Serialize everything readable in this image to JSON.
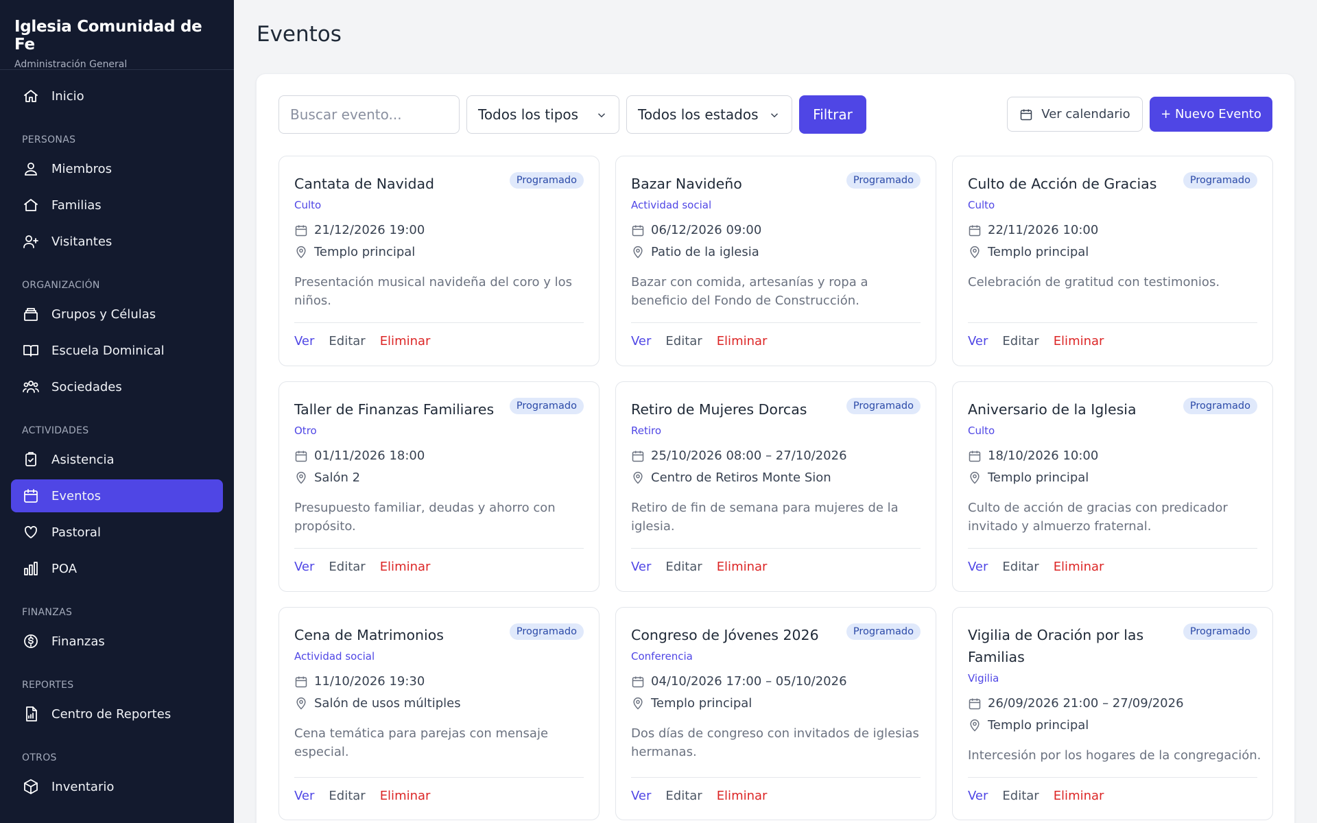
{
  "brand": {
    "title": "Iglesia Comunidad de Fe",
    "subtitle": "Administración General"
  },
  "nav": {
    "inicio": "Inicio",
    "personas": {
      "section": "PERSONAS",
      "items": [
        "Miembros",
        "Familias",
        "Visitantes"
      ]
    },
    "organizacion": {
      "section": "ORGANIZACIÓN",
      "items": [
        "Grupos y Células",
        "Escuela Dominical",
        "Sociedades"
      ]
    },
    "actividades": {
      "section": "ACTIVIDADES",
      "items": [
        "Asistencia",
        "Eventos",
        "Pastoral",
        "POA"
      ]
    },
    "finanzas": {
      "section": "FINANZAS",
      "items": [
        "Finanzas"
      ]
    },
    "reportes": {
      "section": "REPORTES",
      "items": [
        "Centro de Reportes"
      ]
    },
    "otros": {
      "section": "OTROS",
      "items": [
        "Inventario"
      ]
    }
  },
  "page": {
    "title": "Eventos"
  },
  "toolbar": {
    "search_placeholder": "Buscar evento...",
    "type_select": "Todos los tipos",
    "status_select": "Todos los estados",
    "filter_label": "Filtrar",
    "calendar_label": "Ver calendario",
    "new_label": "+ Nuevo Evento"
  },
  "actions": {
    "ver": "Ver",
    "editar": "Editar",
    "eliminar": "Eliminar"
  },
  "events": [
    {
      "title": "Cantata de Navidad",
      "status": "Programado",
      "type": "Culto",
      "date": "21/12/2026 19:00",
      "location": "Templo principal",
      "description": "Presentación musical navideña del coro y los niños."
    },
    {
      "title": "Bazar Navideño",
      "status": "Programado",
      "type": "Actividad social",
      "date": "06/12/2026 09:00",
      "location": "Patio de la iglesia",
      "description": "Bazar con comida, artesanías y ropa a beneficio del Fondo de Construcción."
    },
    {
      "title": "Culto de Acción de Gracias",
      "status": "Programado",
      "type": "Culto",
      "date": "22/11/2026 10:00",
      "location": "Templo principal",
      "description": "Celebración de gratitud con testimonios."
    },
    {
      "title": "Taller de Finanzas Familiares",
      "status": "Programado",
      "type": "Otro",
      "date": "01/11/2026 18:00",
      "location": "Salón 2",
      "description": "Presupuesto familiar, deudas y ahorro con propósito."
    },
    {
      "title": "Retiro de Mujeres Dorcas",
      "status": "Programado",
      "type": "Retiro",
      "date": "25/10/2026 08:00 – 27/10/2026",
      "location": "Centro de Retiros Monte Sion",
      "description": "Retiro de fin de semana para mujeres de la iglesia."
    },
    {
      "title": "Aniversario de la Iglesia",
      "status": "Programado",
      "type": "Culto",
      "date": "18/10/2026 10:00",
      "location": "Templo principal",
      "description": "Culto de acción de gracias con predicador invitado y almuerzo fraternal."
    },
    {
      "title": "Cena de Matrimonios",
      "status": "Programado",
      "type": "Actividad social",
      "date": "11/10/2026 19:30",
      "location": "Salón de usos múltiples",
      "description": "Cena temática para parejas con mensaje especial."
    },
    {
      "title": "Congreso de Jóvenes 2026",
      "status": "Programado",
      "type": "Conferencia",
      "date": "04/10/2026 17:00 – 05/10/2026",
      "location": "Templo principal",
      "description": "Dos días de congreso con invitados de iglesias hermanas."
    },
    {
      "title": "Vigilia de Oración por las Familias",
      "status": "Programado",
      "type": "Vigilia",
      "date": "26/09/2026 21:00 – 27/09/2026",
      "location": "Templo principal",
      "description": "Intercesión por los hogares de la congregación."
    }
  ]
}
